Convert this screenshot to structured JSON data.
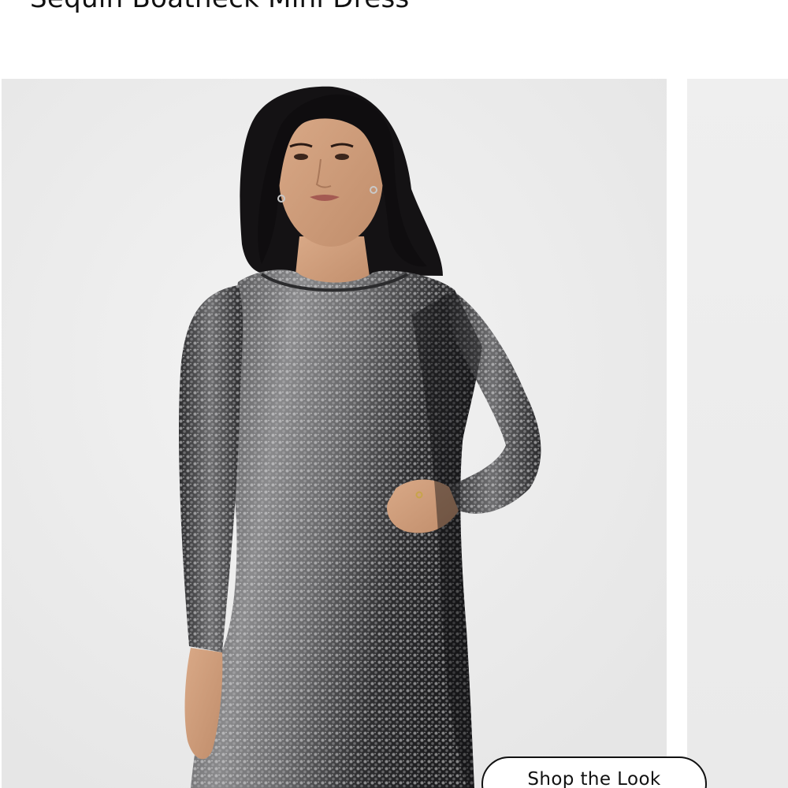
{
  "product": {
    "title": "Sequin Boatneck Mini Dress"
  },
  "gallery": {
    "main_image_alt": "Model wearing a long sleeve silver sequin boatneck mini dress",
    "next_image_alt": "Sequin Boatneck Mini Dress alternate view"
  },
  "actions": {
    "shop_the_look_label": "Shop the Look"
  },
  "colors": {
    "background": "#ffffff",
    "image_backdrop": "#eeeeee",
    "text": "#111111"
  }
}
